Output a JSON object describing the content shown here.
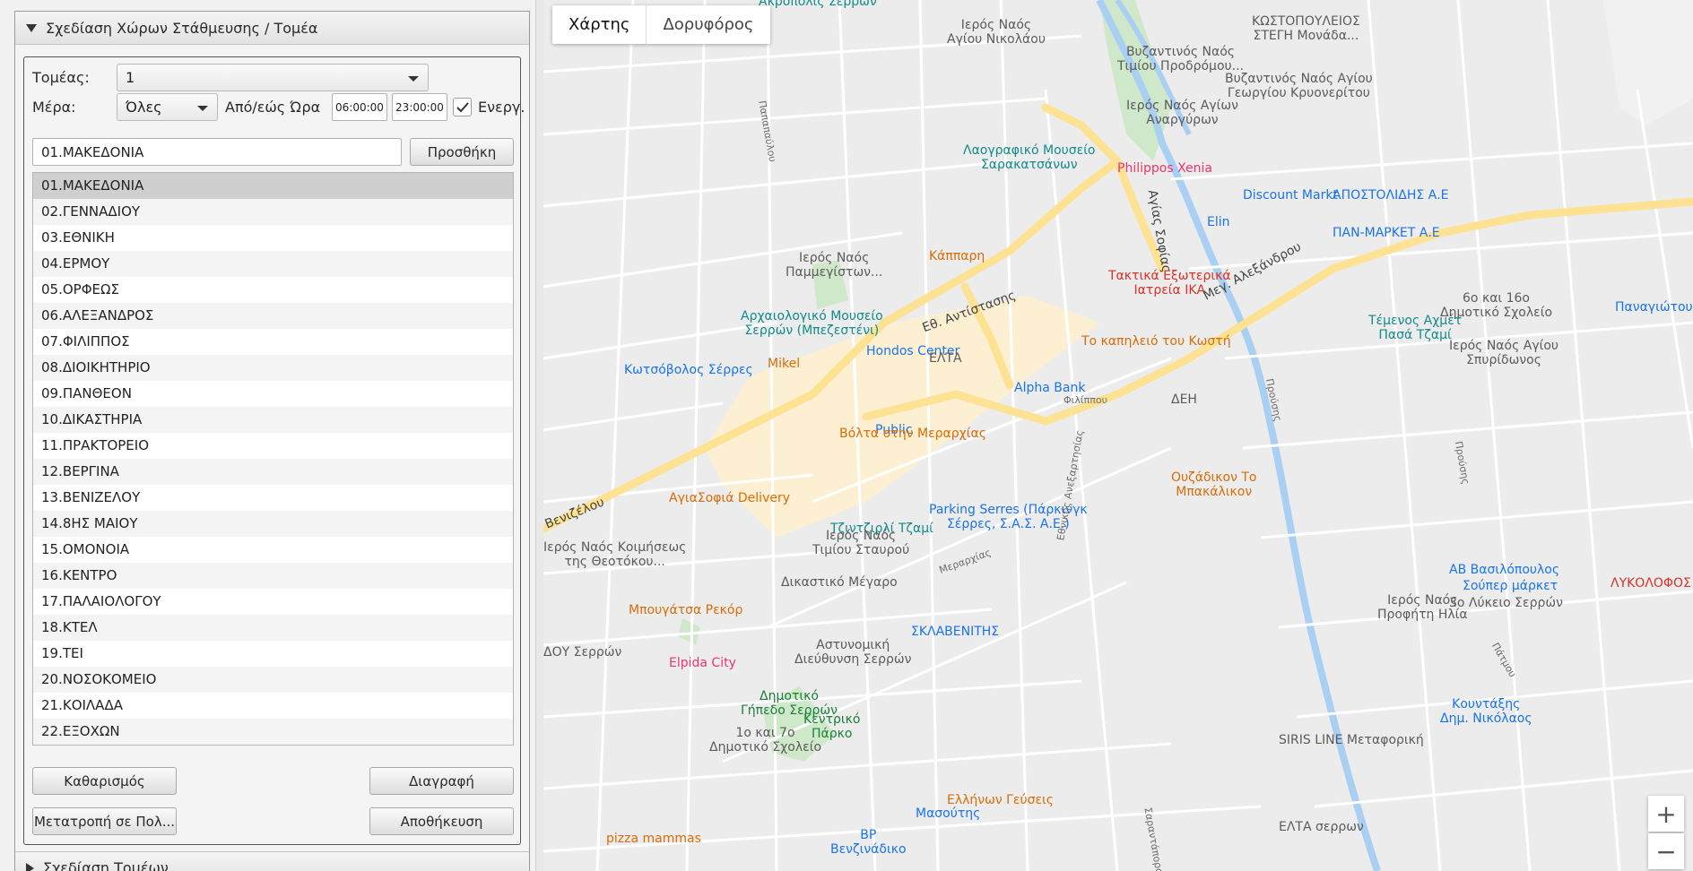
{
  "panel": {
    "section_title": "Σχεδίαση Χώρων Στάθμευσης / Τομέα",
    "bottom_section_title": "Σχεδίαση Τομέων",
    "sector_label": "Τομέας:",
    "sector_value": "1",
    "day_label": "Μέρα:",
    "day_value": "Όλες",
    "time_label": "Από/εώς Ώρα",
    "time_from": "06:00:00",
    "time_to": "23:00:00",
    "active_label": "Ενεργ.",
    "name_input": "01.ΜΑΚΕΔΟΝΙΑ",
    "add_button": "Προσθήκη",
    "clear_button": "Καθαρισμός",
    "delete_button": "Διαγραφή",
    "convert_button": "Μετατροπή σε Πολ...",
    "save_button": "Αποθήκευση",
    "items": [
      "01.ΜΑΚΕΔΟΝΙΑ",
      "02.ΓΕΝΝΑΔΙΟΥ",
      "03.ΕΘΝΙΚΗ",
      "04.ΕΡΜΟΥ",
      "05.ΟΡΦΕΩΣ",
      "06.ΑΛΕΞΑΝΔΡΟΣ",
      "07.ΦΙΛΙΠΠΟΣ",
      "08.ΔΙΟΙΚΗΤΗΡΙΟ",
      "09.ΠΑΝΘΕΟΝ",
      "10.ΔΙΚΑΣΤΗΡΙΑ",
      "11.ΠΡΑΚΤΟΡΕΙΟ",
      "12.ΒΕΡΓΙΝΑ",
      "13.ΒΕΝΙΖΕΛΟΥ",
      "14.8ΗΣ ΜΑΙΟΥ",
      "15.ΟΜΟΝΟΙΑ",
      "16.ΚΕΝΤΡΟ",
      "17.ΠΑΛΑΙΟΛΟΓΟΥ",
      "18.ΚΤΕΛ",
      "19.ΤΕΙ",
      "20.ΝΟΣΟΚΟΜΕΙΟ",
      "21.ΚΟΙΛΑΔΑ",
      "22.ΕΞΟΧΩΝ"
    ]
  },
  "map": {
    "tab_map": "Χάρτης",
    "tab_satellite": "Δορυφόρος",
    "zoom_in": "+",
    "zoom_out": "−",
    "pois": [
      {
        "text": "Ακρόπολις Σερρών",
        "cls": "teal"
      },
      {
        "text": "Ιερός Ναός\nΑγίου Νικολάου",
        "cls": "grey"
      },
      {
        "text": "Βυζαντινός Ναός\nΤιμίου Προδρόμου...",
        "cls": "grey"
      },
      {
        "text": "ΚΩΣΤΟΠΟΥΛΕΙΟΣ\nΣΤΕΓΗ Μονάδα...",
        "cls": "grey"
      },
      {
        "text": "Βυζαντινός Ναός Αγίου\nΓεωργίου Κρυονερίτου",
        "cls": "grey"
      },
      {
        "text": "Ιερός Ναός Αγίων\nΑναργύρων",
        "cls": "grey"
      },
      {
        "text": "Λαογραφικό Μουσείο\nΣαρακατσάνων",
        "cls": "teal"
      },
      {
        "text": "Philippos Xenia",
        "cls": "pink"
      },
      {
        "text": "Discount Markt",
        "cls": "blue"
      },
      {
        "text": "ΑΠΟΣΤΟΛΙΔΗΣ Α.Ε",
        "cls": "blue"
      },
      {
        "text": "Elin",
        "cls": "blue"
      },
      {
        "text": "ΠΑΝ-ΜΑΡΚΕΤ Α.Ε",
        "cls": "blue"
      },
      {
        "text": "Ιερός Ναός\nΠαμμεγίστων...",
        "cls": "grey"
      },
      {
        "text": "Κάππαρη",
        "cls": "orange"
      },
      {
        "text": "Τακτικά Εξωτερικά\nΙατρεία ΙΚΑ",
        "cls": "red"
      },
      {
        "text": "6ο και 16ο\nΔημοτικό Σχολείο",
        "cls": "grey"
      },
      {
        "text": "Παναγιώτου",
        "cls": "blue"
      },
      {
        "text": "Αρχαιολογικό Μουσείο\nΣερρών (Μπεζεστένι)",
        "cls": "teal"
      },
      {
        "text": "Τέμενος Αχμέτ\nΠασά Τζαμί",
        "cls": "teal"
      },
      {
        "text": "Ιερός Ναός Αγίου\nΣπυρίδωνος",
        "cls": "grey"
      },
      {
        "text": "Hondos Center",
        "cls": "blue"
      },
      {
        "text": "ΕΛΤΑ",
        "cls": "grey"
      },
      {
        "text": "Το καπηλειό του Κωστή",
        "cls": "orange"
      },
      {
        "text": "Κωτσόβολος Σέρρες",
        "cls": "blue"
      },
      {
        "text": "Mikel",
        "cls": "orange"
      },
      {
        "text": "Alpha Bank",
        "cls": "blue"
      },
      {
        "text": "ΔΕΗ",
        "cls": "grey"
      },
      {
        "text": "Public",
        "cls": "blue"
      },
      {
        "text": "Βόλτα στην Μεραρχίας",
        "cls": "orange"
      },
      {
        "text": "Ουζάδικον Το\nΜπακάλικον",
        "cls": "orange"
      },
      {
        "text": "ΑγιαΣοφιά Delivery",
        "cls": "orange"
      },
      {
        "text": "Parking Serres (Πάρκινγκ\nΣέρρες, Σ.Α.Σ. Α.Ε.)",
        "cls": "blue"
      },
      {
        "text": "Τζιντζιρλί Τζαμί",
        "cls": "teal"
      },
      {
        "text": "Ιερός Ναός Κοιμήσεως\nτης Θεοτόκου...",
        "cls": "grey"
      },
      {
        "text": "Ιερός Ναός\nΤιμίου Σταυρού",
        "cls": "grey"
      },
      {
        "text": "AB Βασιλόπουλος",
        "cls": "blue"
      },
      {
        "text": "Σούπερ μάρκετ",
        "cls": "blue"
      },
      {
        "text": "ΛΥΚΟΛΟΦΟΣ",
        "cls": "red"
      },
      {
        "text": "Δικαστικό Μέγαρο",
        "cls": "grey"
      },
      {
        "text": "3ο Λύκειο Σερρών",
        "cls": "grey"
      },
      {
        "text": "Ιερός Ναός\nΠροφήτη Ηλία",
        "cls": "grey"
      },
      {
        "text": "Μπουγάτσα Ρεκόρ",
        "cls": "orange"
      },
      {
        "text": "ΣΚΛΑΒΕΝΙΤΗΣ",
        "cls": "blue"
      },
      {
        "text": "Αστυνομική\nΔιεύθυνση Σερρών",
        "cls": "grey"
      },
      {
        "text": "ΔΟΥ Σερρών",
        "cls": "grey"
      },
      {
        "text": "Elpida City",
        "cls": "pink"
      },
      {
        "text": "Δημοτικό\nΓήπεδο Σερρών",
        "cls": "green"
      },
      {
        "text": "Κουντάξης\nΔημ. Νικόλαος",
        "cls": "blue"
      },
      {
        "text": "Κεντρικό\nΠάρκο",
        "cls": "green"
      },
      {
        "text": "1ο και 7ο\nΔημοτικό Σχολείο",
        "cls": "grey"
      },
      {
        "text": "SIRIS LINE Μεταφορική",
        "cls": "grey"
      },
      {
        "text": "Ελλήνων Γεύσεις",
        "cls": "orange"
      },
      {
        "text": "Μασούτης",
        "cls": "blue"
      },
      {
        "text": "ΕΛΤΑ σερρων",
        "cls": "grey"
      },
      {
        "text": "BP\nΒενζινάδικο",
        "cls": "blue"
      },
      {
        "text": "pizza mammas",
        "cls": "orange"
      }
    ],
    "streets": [
      "Εθ. Αντίστασης",
      "Μεγ. Αλεξάνδρου",
      "Βενιζέλου",
      "Αγίας Σοφίας",
      "Παπαπαύλου",
      "Προύσης",
      "Σαραντάπορου",
      "Εθνικής Ανεξαρτησίας",
      "Φιλίππου",
      "Μεραρχίας",
      "Πάτμου"
    ]
  }
}
